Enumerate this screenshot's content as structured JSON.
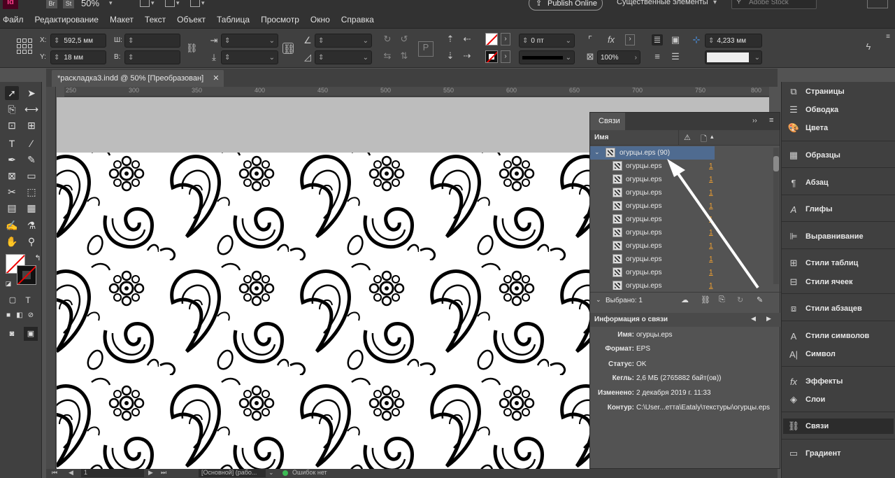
{
  "appbar": {
    "logo": "Id",
    "bridge": "Br",
    "stock": "St",
    "zoom": "50%",
    "publish_label": "Publish Online",
    "workspace": "Существенные элементы",
    "search_placeholder": "Adobe Stock"
  },
  "menu": [
    "Файл",
    "Редактирование",
    "Макет",
    "Текст",
    "Объект",
    "Таблица",
    "Просмотр",
    "Окно",
    "Справка"
  ],
  "control": {
    "x_label": "X:",
    "x_value": "592,5 мм",
    "y_label": "Y:",
    "y_value": "18 мм",
    "w_label": "Ш:",
    "h_label": "В:",
    "stroke_weight": "0 пт",
    "opacity": "100%",
    "gap": "4,233 мм"
  },
  "document": {
    "tab_title": "*раскладка3.indd @ 50% [Преобразован]",
    "close_label": "✕",
    "ruler_ticks": [
      "250",
      "300",
      "350",
      "400",
      "450",
      "500",
      "550",
      "600",
      "650",
      "700",
      "750",
      "800"
    ]
  },
  "status": {
    "page": "1",
    "master": "[Основной] (рабо...",
    "preflight": "Ошибок нет"
  },
  "links_panel": {
    "tab_title": "Связи",
    "col_name": "Имя",
    "group_name": "огурцы.eps (90)",
    "rows": [
      {
        "name": "огурцы.eps",
        "page": "1"
      },
      {
        "name": "огурцы.eps",
        "page": "1"
      },
      {
        "name": "огурцы.eps",
        "page": "1"
      },
      {
        "name": "огурцы.eps",
        "page": "1"
      },
      {
        "name": "огурцы.eps",
        "page": "1"
      },
      {
        "name": "огурцы.eps",
        "page": "1"
      },
      {
        "name": "огурцы.eps",
        "page": "1"
      },
      {
        "name": "огурцы.eps",
        "page": "1"
      },
      {
        "name": "огурцы.eps",
        "page": "1"
      },
      {
        "name": "огурцы.eps",
        "page": "1"
      }
    ],
    "selected_text": "Выбрано: 1",
    "info_title": "Информация о связи",
    "info": [
      {
        "label": "Имя:",
        "value": "огурцы.eps"
      },
      {
        "label": "Формат:",
        "value": "EPS"
      },
      {
        "label": "Статус:",
        "value": "OK"
      },
      {
        "label": "Кегль:",
        "value": "2,6 МБ (2765882 байт(ов))"
      },
      {
        "label": "Изменено:",
        "value": "2 декабря 2019 г. 11:33"
      },
      {
        "label": "Контур:",
        "value": "C:\\User...етта\\Eataly\\текстуры\\огурцы.eps"
      }
    ]
  },
  "right_panel": [
    {
      "label": "Страницы",
      "icon": "pages-icon"
    },
    {
      "label": "Обводка",
      "icon": "stroke-icon"
    },
    {
      "label": "Цвета",
      "icon": "color-icon"
    },
    {
      "label": "Образцы",
      "icon": "swatches-icon"
    },
    {
      "label": "Абзац",
      "icon": "paragraph-icon"
    },
    {
      "label": "Глифы",
      "icon": "glyphs-icon"
    },
    {
      "label": "Выравнивание",
      "icon": "align-icon"
    },
    {
      "label": "Стили таблиц",
      "icon": "table-styles-icon"
    },
    {
      "label": "Стили ячеек",
      "icon": "cell-styles-icon"
    },
    {
      "label": "Стили абзацев",
      "icon": "paragraph-styles-icon"
    },
    {
      "label": "Стили символов",
      "icon": "char-styles-icon"
    },
    {
      "label": "Символ",
      "icon": "character-icon"
    },
    {
      "label": "Эффекты",
      "icon": "effects-icon"
    },
    {
      "label": "Слои",
      "icon": "layers-icon"
    },
    {
      "label": "Связи",
      "icon": "links-icon"
    },
    {
      "label": "Градиент",
      "icon": "gradient-icon"
    }
  ]
}
